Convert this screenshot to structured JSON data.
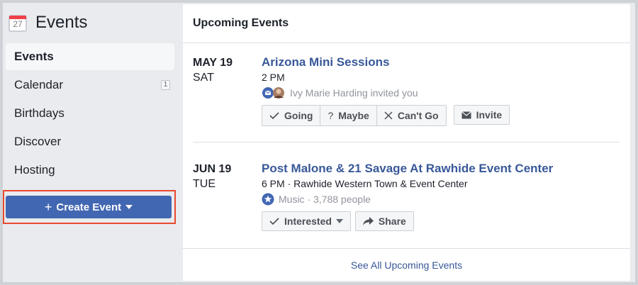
{
  "sidebar": {
    "icon": "calendar-icon",
    "calendar_day": "27",
    "title": "Events",
    "items": [
      {
        "label": "Events",
        "active": true
      },
      {
        "label": "Calendar",
        "badge": "1"
      },
      {
        "label": "Birthdays"
      },
      {
        "label": "Discover"
      },
      {
        "label": "Hosting"
      }
    ],
    "create_button": {
      "label": "Create Event",
      "icon": "plus-icon",
      "color": "#4267b2",
      "highlight_color": "#e8492f"
    }
  },
  "main": {
    "header": "Upcoming Events",
    "events": [
      {
        "month_day": "MAY 19",
        "weekday": "SAT",
        "title": "Arizona Mini Sessions",
        "time": "2 PM",
        "meta": "Ivy Marie Harding invited you",
        "meta_icon": "message-avatar-icon",
        "buttons": {
          "going": "Going",
          "maybe": "Maybe",
          "cant_go": "Can't Go",
          "invite": "Invite"
        }
      },
      {
        "month_day": "JUN 19",
        "weekday": "TUE",
        "title": "Post Malone & 21 Savage At Rawhide Event Center",
        "time": "6 PM · Rawhide Western Town & Event Center",
        "meta": "Music · 3,788 people",
        "meta_icon": "star-badge-icon",
        "buttons": {
          "interested": "Interested",
          "share": "Share"
        }
      }
    ],
    "footer_link": "See All Upcoming Events"
  },
  "colors": {
    "link": "#385898",
    "page_bg": "#e9ebee",
    "card_bg": "#ffffff"
  }
}
